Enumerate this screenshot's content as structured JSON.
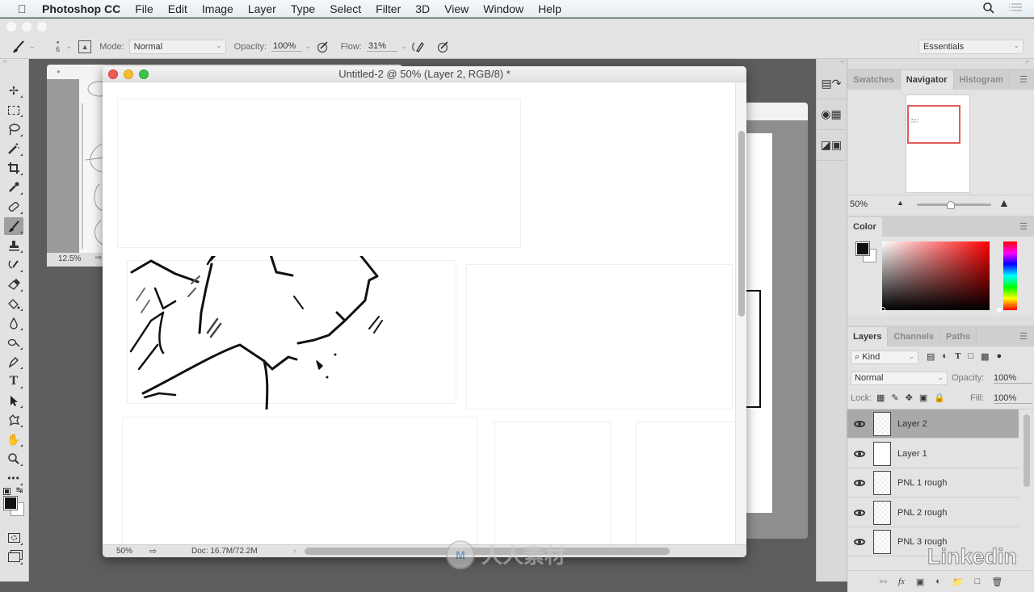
{
  "menubar": {
    "app_name": "Photoshop CC",
    "items": [
      "File",
      "Edit",
      "Image",
      "Layer",
      "Type",
      "Select",
      "Filter",
      "3D",
      "View",
      "Window",
      "Help"
    ]
  },
  "options_bar": {
    "brush_size": "6",
    "mode_label": "Mode:",
    "mode_value": "Normal",
    "opacity_label": "Opacity:",
    "opacity_value": "100%",
    "flow_label": "Flow:",
    "flow_value": "31%",
    "workspace": "Essentials"
  },
  "toolbar": {
    "tools": [
      "move-tool",
      "marquee-tool",
      "lasso-tool",
      "magic-wand-tool",
      "crop-tool",
      "eyedropper-tool",
      "healing-brush-tool",
      "brush-tool",
      "clone-stamp-tool",
      "history-brush-tool",
      "eraser-tool",
      "paint-bucket-tool",
      "blur-tool",
      "dodge-tool",
      "pen-tool",
      "type-tool",
      "path-selection-tool",
      "custom-shape-tool",
      "hand-tool",
      "zoom-tool",
      "more-tools"
    ],
    "selected_tool": "brush-tool",
    "foreground_color": "#111111",
    "background_color": "#ffffff"
  },
  "documents": {
    "background_doc": {
      "zoom": "12.5%"
    },
    "active_doc": {
      "title": "Untitled-2 @ 50% (Layer 2, RGB/8) *",
      "zoom": "50%",
      "doc_size": "Doc: 16.7M/72.2M"
    }
  },
  "navigator_panel": {
    "tabs": [
      "Swatches",
      "Navigator",
      "Histogram"
    ],
    "active_tab": "Navigator",
    "zoom": "50%",
    "zoom_slider_fraction": 0.45
  },
  "color_panel": {
    "title": "Color",
    "hue_color": "#ff0000"
  },
  "layers_panel": {
    "tabs": [
      "Layers",
      "Channels",
      "Paths"
    ],
    "active_tab": "Layers",
    "filter_kind": "Kind",
    "blend_mode": "Normal",
    "opacity_label": "Opacity:",
    "opacity_value": "100%",
    "lock_label": "Lock:",
    "fill_label": "Fill:",
    "fill_value": "100%",
    "layers": [
      {
        "name": "Layer 2",
        "visible": true,
        "selected": true
      },
      {
        "name": "Layer 1",
        "visible": true,
        "selected": false
      },
      {
        "name": "PNL 1 rough",
        "visible": true,
        "selected": false
      },
      {
        "name": "PNL 2 rough",
        "visible": true,
        "selected": false
      },
      {
        "name": "PNL 3 rough",
        "visible": true,
        "selected": false
      }
    ]
  },
  "watermarks": {
    "bottom_center": "人人素材",
    "bottom_right": "Linkedin"
  },
  "colors": {
    "close": "#ee5b52",
    "minimize": "#f5be2f",
    "zoom": "#39c54a",
    "navigator_frame": "#e05a5a"
  }
}
